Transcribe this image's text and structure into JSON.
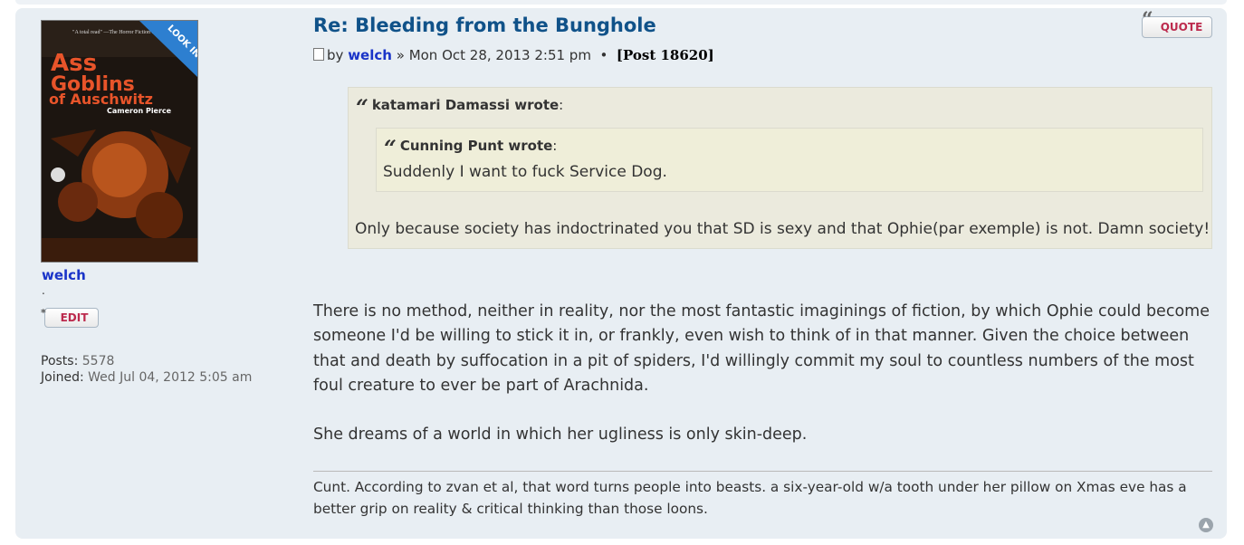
{
  "post": {
    "title": "Re: Bleeding from the Bunghole",
    "by_label": "by",
    "author": "welch",
    "sep": "»",
    "date": "Mon Oct 28, 2013 2:51 pm",
    "bullet": "•",
    "post_number": "[Post 18620]",
    "quote_button": "QUOTE"
  },
  "profile": {
    "username": "welch",
    "rank": ".",
    "edit_button": "EDIT",
    "posts_label": "Posts:",
    "posts_value": "5578",
    "joined_label": "Joined:",
    "joined_value": "Wed Jul 04, 2012 5:05 am",
    "avatar": {
      "badge": "LOOK INSIDE",
      "blurb": "\"A total read\" —The Horror Fiction Review",
      "title_line1": "Ass",
      "title_line2": "Goblins",
      "title_line3": "of Auschwitz",
      "author": "Cameron Pierce"
    }
  },
  "quote_outer": {
    "cite_name": "katamari Damassi wrote",
    "colon": ":",
    "text": "Only because society has indoctrinated you that SD is sexy and that Ophie(par exemple) is not. Damn society!"
  },
  "quote_inner": {
    "cite_name": "Cunning Punt wrote",
    "colon": ":",
    "text": "Suddenly I want to fuck Service Dog."
  },
  "body": {
    "paragraph1": "There is no method, neither in reality, nor the most fantastic imaginings of fiction, by which Ophie could become someone I'd be willing to stick it in, or frankly, even wish to think of in that manner. Given the choice between that and death by suffocation in a pit of spiders, I'd willingly commit my soul to countless numbers of the most foul creature to ever be part of Arachnida.",
    "paragraph2": "She dreams of a world in which her ugliness is only skin-deep."
  },
  "signature": "Cunt. According to zvan et al, that word turns people into beasts. a six-year-old w/a tooth under her pillow on Xmas eve has a better grip on reality & critical thinking than those loons.",
  "icons": {
    "quote_mark": "“",
    "top": "▲",
    "edit_star": "*"
  },
  "colors": {
    "post_bg": "#e8eef3",
    "title": "#105289",
    "author_link": "#1a34c8",
    "button_text": "#bc2a4d",
    "quote_bg": "#ebeadd"
  }
}
